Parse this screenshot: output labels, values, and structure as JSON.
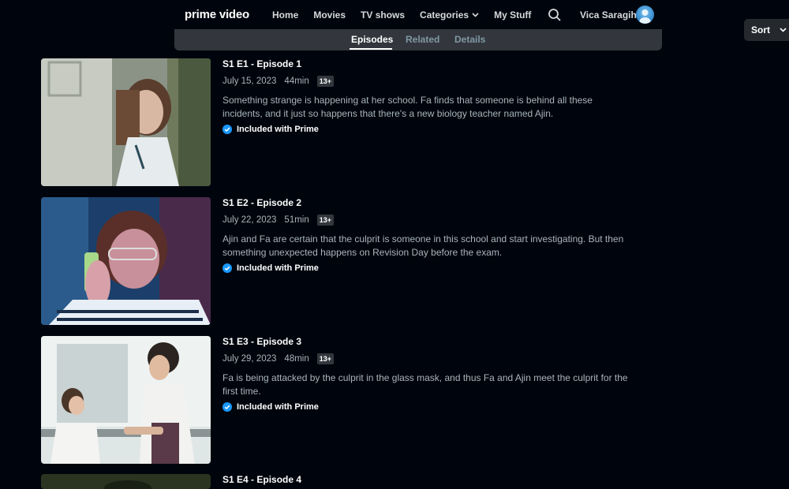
{
  "nav": {
    "logo": "prime video",
    "links": [
      "Home",
      "Movies",
      "TV shows",
      "Categories",
      "My Stuff"
    ],
    "username": "Vica Saragih"
  },
  "tabs": [
    "Episodes",
    "Related",
    "Details"
  ],
  "active_tab": "Episodes",
  "sort": {
    "label": "Sort"
  },
  "episodes": [
    {
      "title": "S1 E1 - Episode 1",
      "date": "July 15, 2023",
      "duration": "44min",
      "rating": "13+",
      "description": "Something strange is happening at her school. Fa finds that someone is behind all these incidents, and it just so happens that there's a new biology teacher named Ajin.",
      "badge": "Included with Prime"
    },
    {
      "title": "S1 E2 - Episode 2",
      "date": "July 22, 2023",
      "duration": "51min",
      "rating": "13+",
      "description": "Ajin and Fa are certain that the culprit is someone in this school and start investigating. But then something unexpected happens on Revision Day before the exam.",
      "badge": "Included with Prime"
    },
    {
      "title": "S1 E3 - Episode 3",
      "date": "July 29, 2023",
      "duration": "48min",
      "rating": "13+",
      "description": "Fa is being attacked by the culprit in the glass mask, and thus Fa and Ajin meet the culprit for the first time.",
      "badge": "Included with Prime"
    },
    {
      "title": "S1 E4 - Episode 4"
    }
  ],
  "colors": {
    "background": "#00050d",
    "tab_bar": "#33373d",
    "prime_blue": "#1a98ff",
    "muted_text": "#aab3bb"
  }
}
